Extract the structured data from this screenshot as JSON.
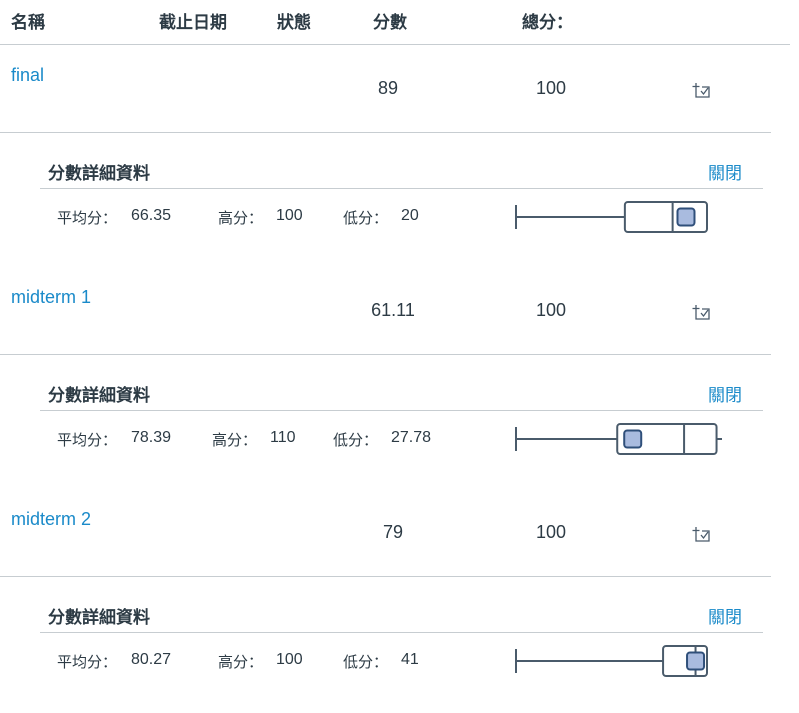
{
  "header": {
    "name": "名稱",
    "due_date": "截止日期",
    "status": "狀態",
    "score": "分數",
    "total": "總分："
  },
  "assignments": [
    {
      "name": "final",
      "score": "89",
      "total": "100",
      "details_icon": "score-details-icon",
      "details": {
        "title": "分數詳細資料",
        "close_label": "關閉",
        "mean_label": "平均分：",
        "mean": "66.35",
        "high_label": "高分：",
        "high": "100",
        "low_label": "低分：",
        "low": "20"
      },
      "boxplot": {
        "min": 20,
        "q1": 57,
        "median": 82,
        "q3": 100,
        "max": 100,
        "your_score": 89,
        "axis_max": 100
      }
    },
    {
      "name": "midterm 1",
      "score": "61.11",
      "total": "100",
      "details_icon": "score-details-icon",
      "details": {
        "title": "分數詳細資料",
        "close_label": "關閉",
        "mean_label": "平均分：",
        "mean": "78.39",
        "high_label": "高分：",
        "high": "110",
        "low_label": "低分：",
        "low": "27.78"
      },
      "boxplot": {
        "min": 27.78,
        "q1": 53,
        "median": 88,
        "q3": 105,
        "max": 110,
        "your_score": 61.11,
        "axis_max": 100
      }
    },
    {
      "name": "midterm 2",
      "score": "79",
      "total": "100",
      "details_icon": "score-details-icon",
      "details": {
        "title": "分數詳細資料",
        "close_label": "關閉",
        "mean_label": "平均分：",
        "mean": "80.27",
        "high_label": "高分：",
        "high": "100",
        "low_label": "低分：",
        "low": "41"
      },
      "boxplot": {
        "min": 41,
        "q1": 77,
        "median": 94,
        "q3": 100,
        "max": 100,
        "your_score": 94,
        "axis_max": 100
      }
    }
  ],
  "colors": {
    "link": "#1a8ac9",
    "text": "#2d3b45",
    "rule": "#c7cdd1",
    "boxplot_stroke": "#4a5b6b",
    "marker_fill": "#a9bbdf"
  }
}
